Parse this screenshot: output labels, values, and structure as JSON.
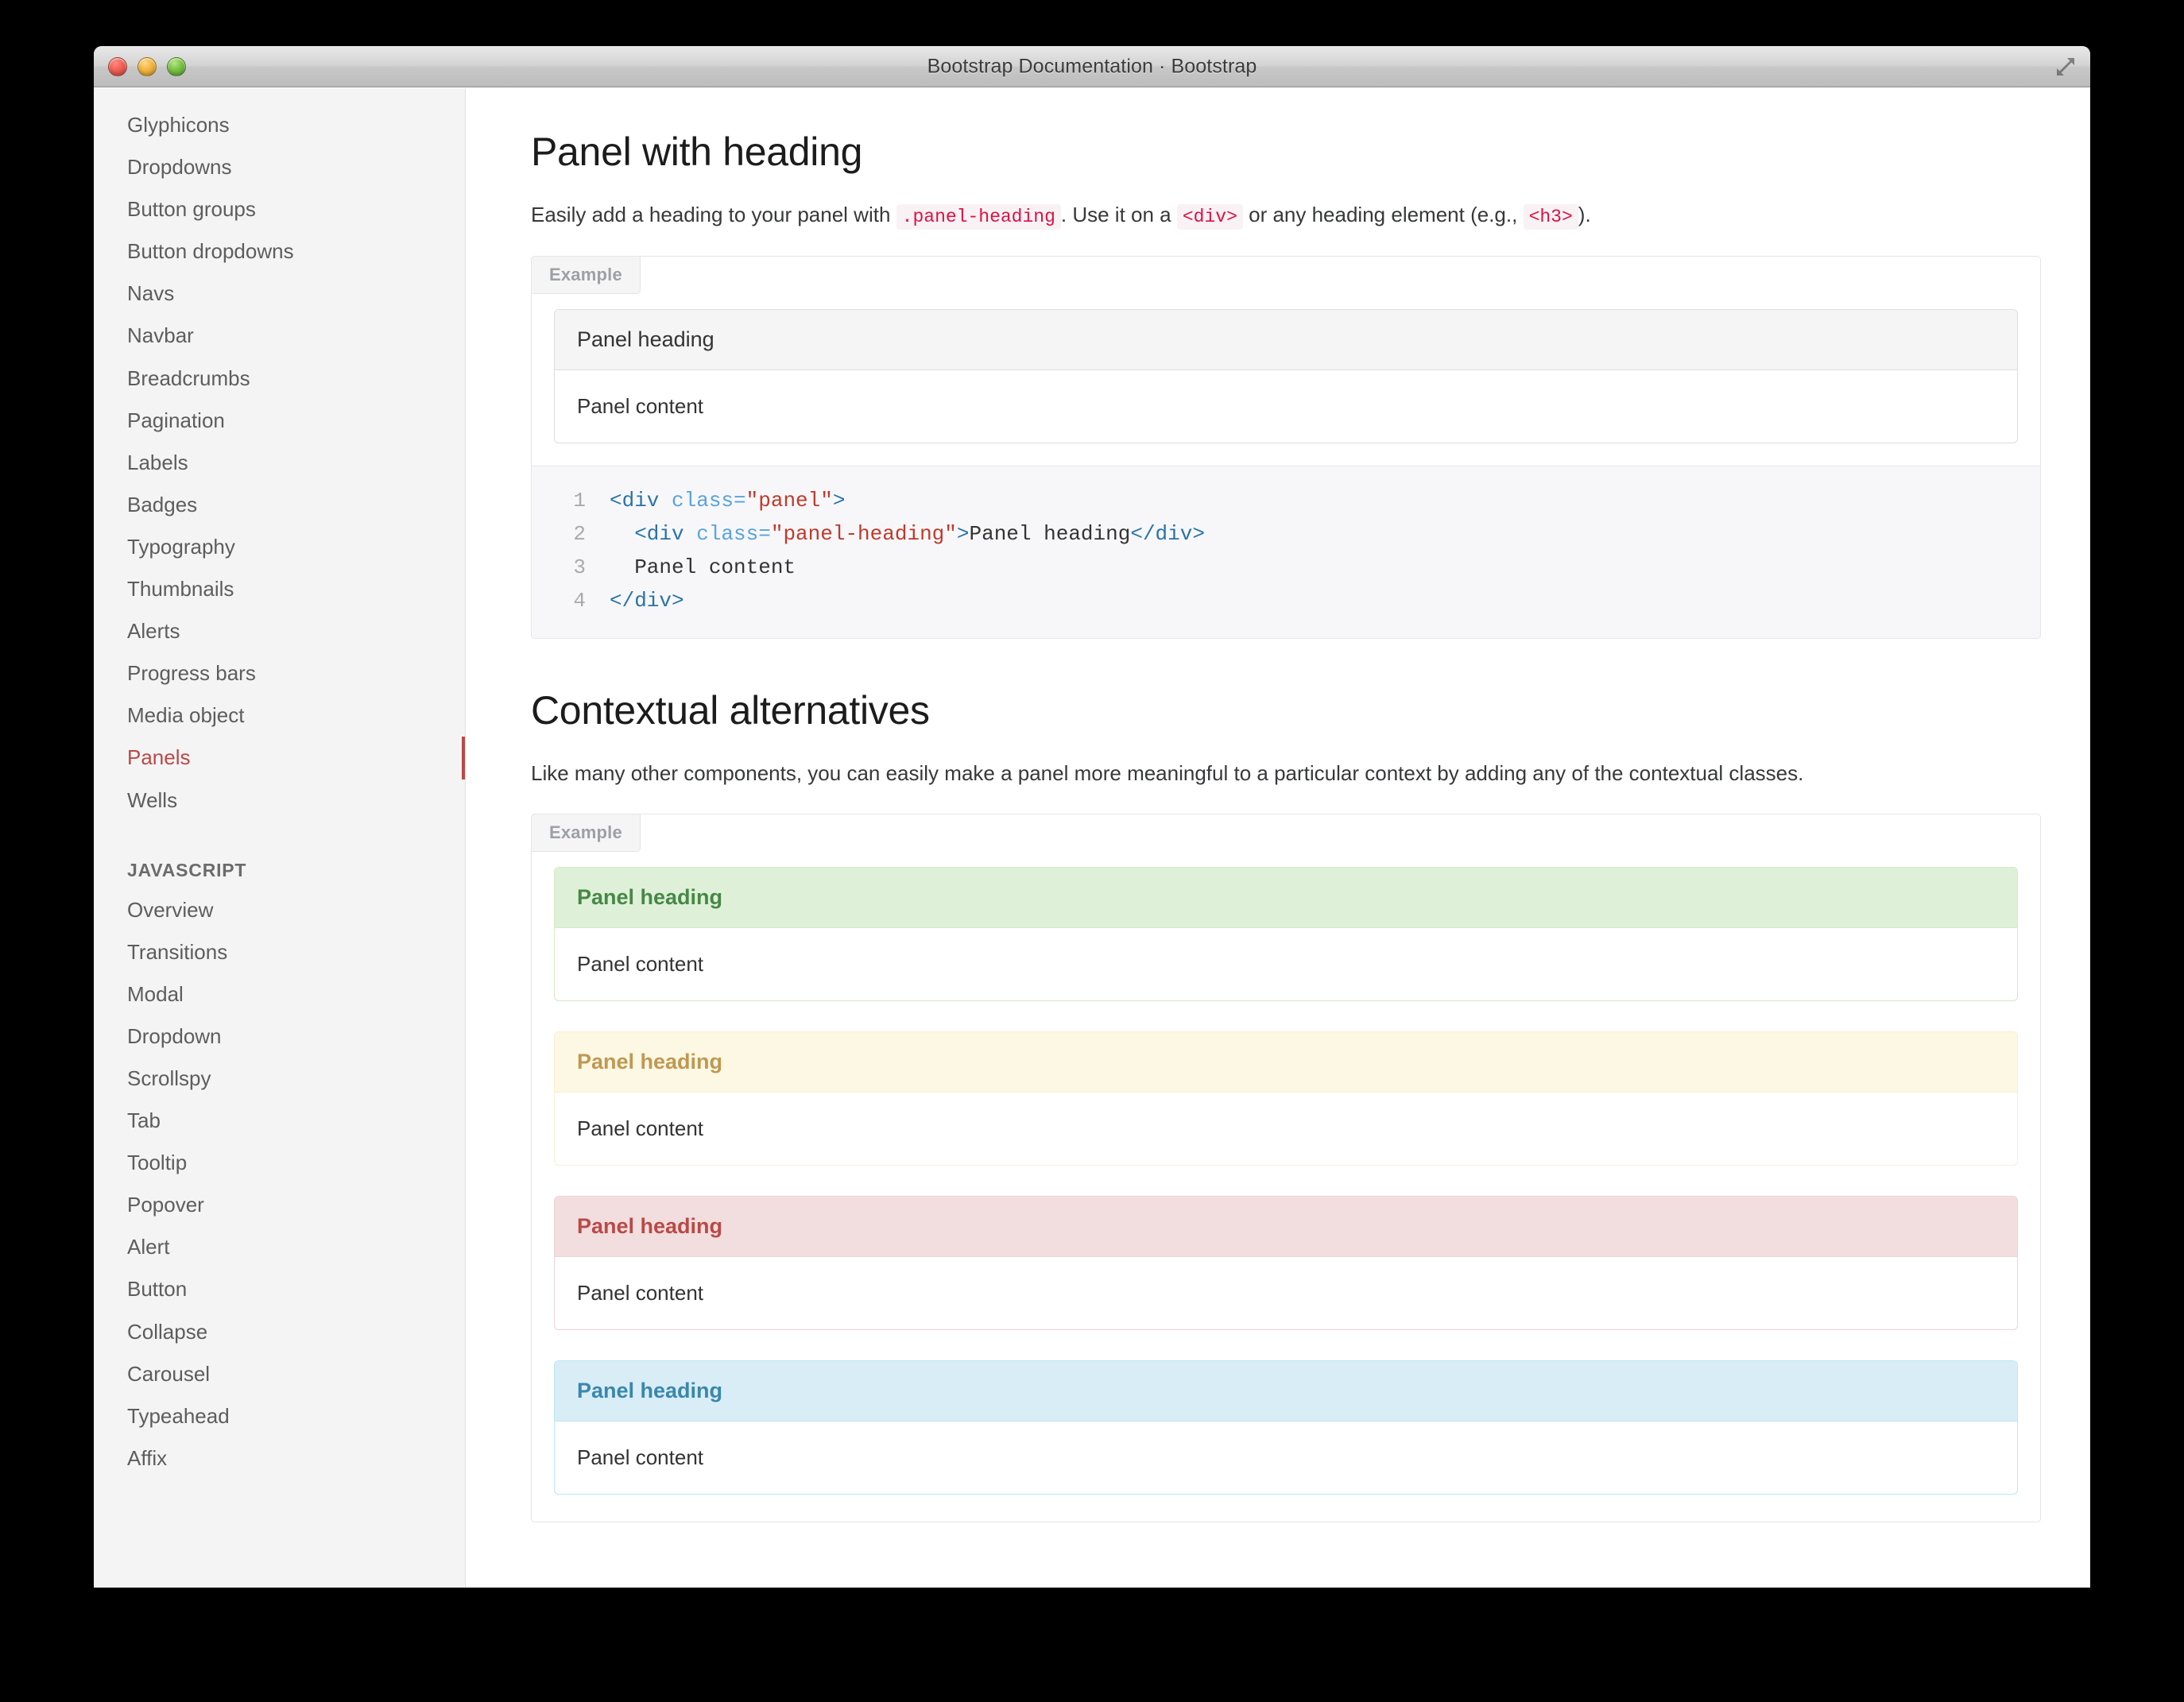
{
  "window": {
    "title": "Bootstrap Documentation · Bootstrap",
    "controls": {
      "close": "close-button",
      "minimize": "minimize-button",
      "zoom": "zoom-button",
      "fullscreen": "fullscreen-button"
    }
  },
  "sidebar": {
    "items": [
      {
        "label": "Glyphicons",
        "active": false
      },
      {
        "label": "Dropdowns",
        "active": false
      },
      {
        "label": "Button groups",
        "active": false
      },
      {
        "label": "Button dropdowns",
        "active": false
      },
      {
        "label": "Navs",
        "active": false
      },
      {
        "label": "Navbar",
        "active": false
      },
      {
        "label": "Breadcrumbs",
        "active": false
      },
      {
        "label": "Pagination",
        "active": false
      },
      {
        "label": "Labels",
        "active": false
      },
      {
        "label": "Badges",
        "active": false
      },
      {
        "label": "Typography",
        "active": false
      },
      {
        "label": "Thumbnails",
        "active": false
      },
      {
        "label": "Alerts",
        "active": false
      },
      {
        "label": "Progress bars",
        "active": false
      },
      {
        "label": "Media object",
        "active": false
      },
      {
        "label": "Panels",
        "active": true
      },
      {
        "label": "Wells",
        "active": false
      }
    ],
    "section_label": "JAVASCRIPT",
    "js_items": [
      {
        "label": "Overview"
      },
      {
        "label": "Transitions"
      },
      {
        "label": "Modal"
      },
      {
        "label": "Dropdown"
      },
      {
        "label": "Scrollspy"
      },
      {
        "label": "Tab"
      },
      {
        "label": "Tooltip"
      },
      {
        "label": "Popover"
      },
      {
        "label": "Alert"
      },
      {
        "label": "Button"
      },
      {
        "label": "Collapse"
      },
      {
        "label": "Carousel"
      },
      {
        "label": "Typeahead"
      },
      {
        "label": "Affix"
      }
    ],
    "active_color": "#b94a48"
  },
  "main": {
    "section1": {
      "title": "Panel with heading",
      "desc_part1": "Easily add a heading to your panel with",
      "code1": ".panel-heading",
      "desc_part2": ". Use it on a",
      "code2": "<div>",
      "desc_part3": "or any heading element (e.g.,",
      "code3": "<h3>",
      "desc_part4": ").",
      "example_label": "Example",
      "panel": {
        "heading": "Panel heading",
        "body": "Panel content"
      },
      "code_block": {
        "lines": [
          {
            "num": "1",
            "tag_open": "<div ",
            "attr": "class=",
            "str": "\"panel\"",
            "tag_close": ">",
            "indent": ""
          },
          {
            "num": "2",
            "tag_open": "<div ",
            "attr": "class=",
            "str": "\"panel-heading\"",
            "tag_close": ">",
            "text": "Panel heading",
            "tag_end": "</div>",
            "indent": "  "
          },
          {
            "num": "3",
            "plain": "  Panel content"
          },
          {
            "num": "4",
            "tag_close_only": "</div>",
            "indent": ""
          }
        ]
      }
    },
    "section2": {
      "title": "Contextual alternatives",
      "desc": "Like many other components, you can easily make a panel more meaningful to a particular context by adding any of the contextual classes.",
      "example_label": "Example",
      "panels": [
        {
          "variant": "success",
          "heading": "Panel heading",
          "body": "Panel content",
          "heading_bg": "#dff0d8",
          "heading_color": "#468847",
          "border": "#d6e9c6"
        },
        {
          "variant": "warning",
          "heading": "Panel heading",
          "body": "Panel content",
          "heading_bg": "#fcf8e3",
          "heading_color": "#c09853",
          "border": "#fbeed5"
        },
        {
          "variant": "danger",
          "heading": "Panel heading",
          "body": "Panel content",
          "heading_bg": "#f2dede",
          "heading_color": "#b94a48",
          "border": "#eed3d7"
        },
        {
          "variant": "info",
          "heading": "Panel heading",
          "body": "Panel content",
          "heading_bg": "#d9edf7",
          "heading_color": "#3a87ad",
          "border": "#bce8f1"
        }
      ]
    }
  }
}
